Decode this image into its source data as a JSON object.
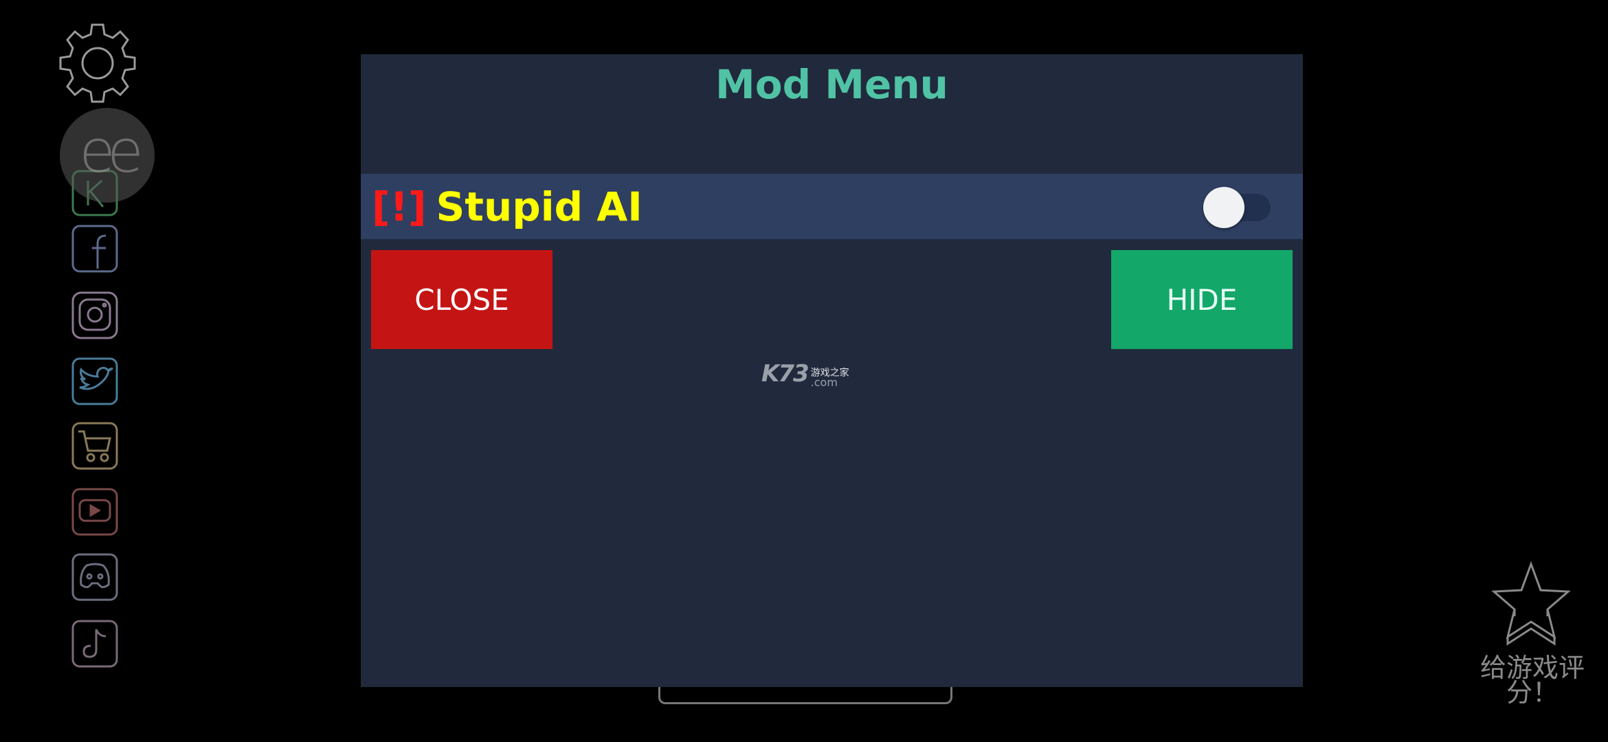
{
  "modal": {
    "title": "Mod Menu",
    "features": [
      {
        "warning_tag": "[!]",
        "label": "Stupid AI",
        "enabled": false
      }
    ],
    "buttons": {
      "close": "CLOSE",
      "hide": "HIDE"
    },
    "watermark": {
      "brand": "K73",
      "cn": "游戏之家",
      "domain": ".com"
    }
  },
  "sidebar": {
    "icons": [
      "settings",
      "overlay-ee",
      "kongregate",
      "facebook",
      "instagram",
      "twitter",
      "shop",
      "youtube",
      "discord",
      "tiktok"
    ]
  },
  "rate": {
    "line1": "给游戏评",
    "line2": "分！"
  },
  "colors": {
    "modal_bg": "#212a3d",
    "row_bg": "#2f3f61",
    "title": "#50c3a5",
    "feature_text": "#ffff00",
    "warning": "#ff1a1a",
    "close": "#c41414",
    "hide": "#13a76a"
  }
}
